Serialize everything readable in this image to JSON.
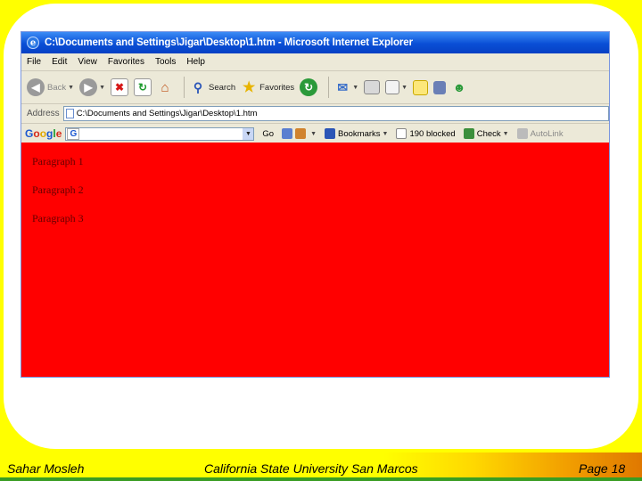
{
  "window": {
    "title": "C:\\Documents and Settings\\Jigar\\Desktop\\1.htm - Microsoft Internet Explorer"
  },
  "menubar": {
    "items": [
      "File",
      "Edit",
      "View",
      "Favorites",
      "Tools",
      "Help"
    ]
  },
  "toolbar": {
    "back_label": "Back",
    "search_label": "Search",
    "favorites_label": "Favorites"
  },
  "addressbar": {
    "label": "Address",
    "value": "C:\\Documents and Settings\\Jigar\\Desktop\\1.htm"
  },
  "googlebar": {
    "go_label": "Go",
    "bookmarks_label": "Bookmarks",
    "blocked_label": "190 blocked",
    "check_label": "Check",
    "autolink_label": "AutoLink"
  },
  "page": {
    "background": "#ff0000",
    "paragraphs": [
      "Paragraph 1",
      "Paragraph 2",
      "Paragraph 3"
    ]
  },
  "footer": {
    "author": "Sahar Mosleh",
    "institution": "California State University San Marcos",
    "page": "Page 18"
  }
}
